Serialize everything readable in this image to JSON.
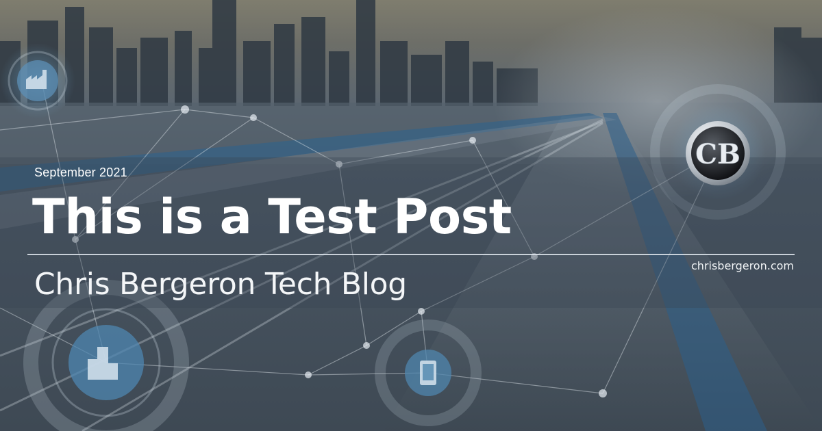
{
  "post": {
    "date": "September 2021",
    "title": "This is a Test Post",
    "blog_name": "Chris Bergeron Tech Blog",
    "site_url": "chrisbergeron.com"
  },
  "logo": {
    "monogram": "CB"
  },
  "colors": {
    "text": "#ffffff",
    "divider": "#e1e8ee",
    "overlay": "#46525e",
    "logo_metal": "#c7ccd2"
  },
  "background": {
    "icons": [
      "factory-icon",
      "buildings-icon",
      "mobile-phone-icon"
    ]
  }
}
